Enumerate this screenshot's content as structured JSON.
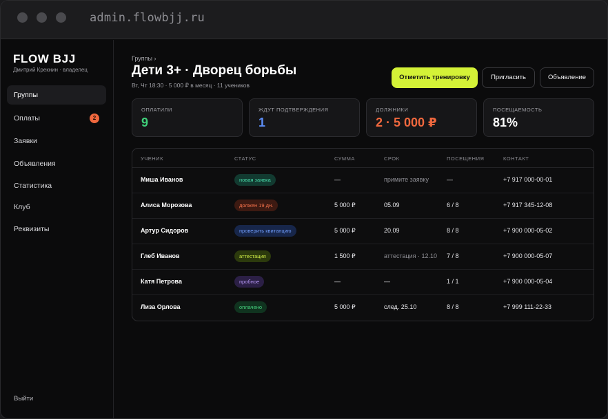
{
  "window": {
    "url": "admin.flowbjj.ru"
  },
  "sidebar": {
    "brand": "FLOW BJJ",
    "owner": "Дмитрий Крекнин · владелец",
    "items": [
      {
        "label": "Группы",
        "active": true
      },
      {
        "label": "Оплаты",
        "badge": "2"
      },
      {
        "label": "Заявки"
      },
      {
        "label": "Объявления"
      },
      {
        "label": "Статистика"
      },
      {
        "label": "Клуб"
      },
      {
        "label": "Реквизиты"
      }
    ],
    "logout": "Выйти"
  },
  "header": {
    "breadcrumb": "Группы ›",
    "title": "Дети 3+ · Дворец борьбы",
    "subtitle": "Вт, Чт 18:30 · 5 000 ₽ в месяц · 11 учеников",
    "primary_button": "Отметить тренировку",
    "invite_button": "Пригласить",
    "announce_button": "Объявление"
  },
  "stats": [
    {
      "label": "ОПЛАТИЛИ",
      "value": "9",
      "color": "#3fd07a"
    },
    {
      "label": "ЖДУТ ПОДТВЕРЖДЕНИЯ",
      "value": "1",
      "color": "#5c8df6"
    },
    {
      "label": "ДОЛЖНИКИ",
      "value": "2 · 5 000 ₽",
      "color": "#f0683e"
    },
    {
      "label": "ПОСЕЩАЕМОСТЬ",
      "value": "81%",
      "color": "#ffffff"
    }
  ],
  "table": {
    "columns": [
      "УЧЕНИК",
      "СТАТУС",
      "СУММА",
      "СРОК",
      "ПОСЕЩЕНИЯ",
      "КОНТАКТ"
    ],
    "rows": [
      {
        "name": "Миша Иванов",
        "status": "новая заявка",
        "status_kind": "new",
        "amount": "—",
        "due": "примите заявку",
        "due_muted": true,
        "visits": "—",
        "contact": "+7 917 000-00-01"
      },
      {
        "name": "Алиса Морозова",
        "status": "должен 19 дн.",
        "status_kind": "debt",
        "amount": "5 000 ₽",
        "due": "05.09",
        "due_muted": false,
        "visits": "6 / 8",
        "contact": "+7 917 345-12-08"
      },
      {
        "name": "Артур Сидоров",
        "status": "проверить квитанцию",
        "status_kind": "check",
        "amount": "5 000 ₽",
        "due": "20.09",
        "due_muted": false,
        "visits": "8 / 8",
        "contact": "+7 900 000-05-02"
      },
      {
        "name": "Глеб Иванов",
        "status": "аттестация",
        "status_kind": "attest",
        "amount": "1 500 ₽",
        "due": "аттестация · 12.10",
        "due_muted": true,
        "visits": "7 / 8",
        "contact": "+7 900 000-05-07"
      },
      {
        "name": "Катя Петрова",
        "status": "пробное",
        "status_kind": "trial",
        "amount": "—",
        "due": "—",
        "due_muted": false,
        "visits": "1 / 1",
        "contact": "+7 900 000-05-04"
      },
      {
        "name": "Лиза Орлова",
        "status": "оплачено",
        "status_kind": "paid",
        "amount": "5 000 ₽",
        "due": "след. 25.10",
        "due_muted": false,
        "visits": "8 / 8",
        "contact": "+7 999 111-22-33"
      }
    ]
  },
  "status_colors": {
    "new": {
      "bg": "#123a30",
      "fg": "#47d6a6"
    },
    "debt": {
      "bg": "#3d1a12",
      "fg": "#f2704a"
    },
    "check": {
      "bg": "#17264a",
      "fg": "#6e9af7"
    },
    "attest": {
      "bg": "#2c3a0d",
      "fg": "#cdea45"
    },
    "trial": {
      "bg": "#2b1f45",
      "fg": "#b596f2"
    },
    "paid": {
      "bg": "#10331f",
      "fg": "#45cf7d"
    }
  }
}
